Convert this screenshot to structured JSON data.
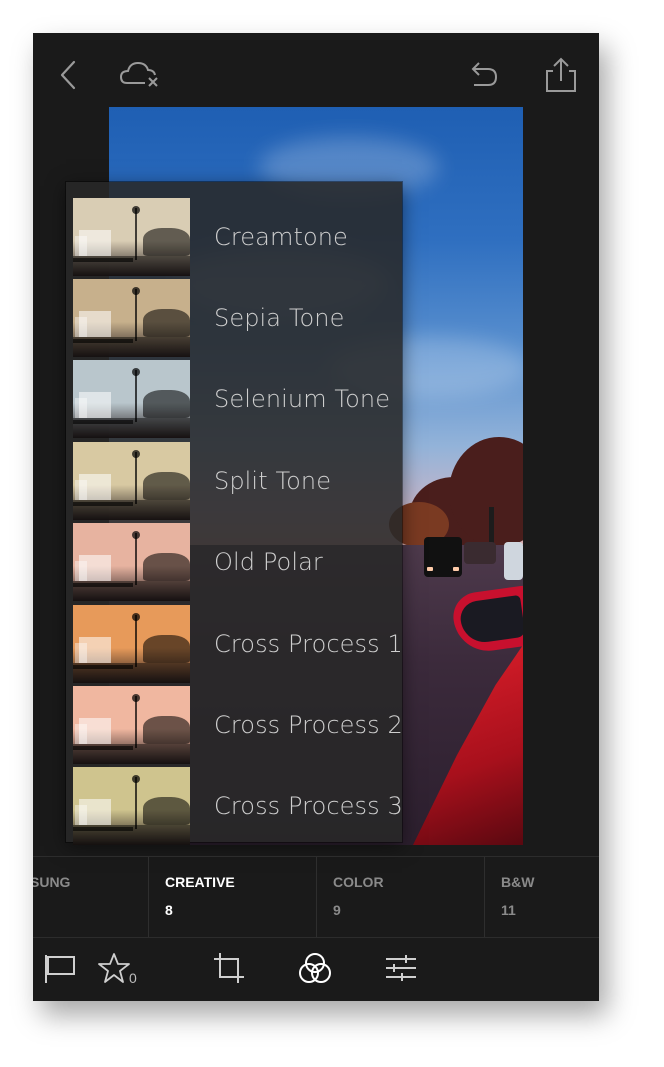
{
  "topbar": {
    "back": "chevron-left-icon",
    "cloud_sync": "cloud-off-icon",
    "undo": "undo-icon",
    "share": "share-icon"
  },
  "presets": [
    {
      "label": "Creamtone",
      "tint": "#d9cdb4"
    },
    {
      "label": "Sepia Tone",
      "tint": "#c7b08c"
    },
    {
      "label": "Selenium Tone",
      "tint": "#b9c6cc"
    },
    {
      "label": "Split Tone",
      "tint": "#d8c9a2"
    },
    {
      "label": "Old Polar",
      "tint": "#e7b3a0"
    },
    {
      "label": "Cross Process 1",
      "tint": "#e79a5a"
    },
    {
      "label": "Cross Process 2",
      "tint": "#f0b7a0"
    },
    {
      "label": "Cross Process 3",
      "tint": "#cfc48e"
    }
  ],
  "tabs": [
    {
      "name": "SUNG",
      "count": ""
    },
    {
      "name": "CREATIVE",
      "count": "8"
    },
    {
      "name": "COLOR",
      "count": "9"
    },
    {
      "name": "B&W",
      "count": "11"
    }
  ],
  "toolbar": {
    "flag": "flag-icon",
    "rating": "star-icon",
    "rating_count": "0",
    "crop": "crop-icon",
    "presets": "presets-circles-icon",
    "adjust": "sliders-icon"
  },
  "colors": {
    "background": "#1a1a1a",
    "panel": "#282828",
    "active_tab": "#ffffff",
    "inactive_tab": "#8a8a8a"
  }
}
